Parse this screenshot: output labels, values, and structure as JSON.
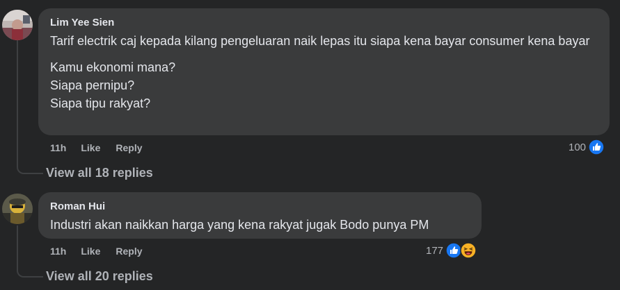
{
  "comments": [
    {
      "author": "Lim Yee Sien",
      "paragraphs": [
        "Tarif electrik caj kepada kilang pengeluaran naik lepas itu siapa kena bayar consumer kena bayar",
        "Kamu ekonomi mana?\nSiapa pernipu?\nSiapa tipu rakyat?"
      ],
      "time": "11h",
      "like_label": "Like",
      "reply_label": "Reply",
      "reaction_count": "100",
      "reactions": [
        "like-icon"
      ],
      "view_replies": "View all 18 replies"
    },
    {
      "author": "Roman Hui",
      "paragraphs": [
        "Industri akan naikkan harga yang kena rakyat jugak Bodo punya PM"
      ],
      "time": "11h",
      "like_label": "Like",
      "reply_label": "Reply",
      "reaction_count": "177",
      "reactions": [
        "like-icon",
        "haha-icon"
      ],
      "view_replies": "View all 20 replies"
    }
  ],
  "colors": {
    "background": "#242526",
    "bubble": "#3a3b3c",
    "like_blue": "#1877f2",
    "haha_yellow": "#f7b125"
  }
}
